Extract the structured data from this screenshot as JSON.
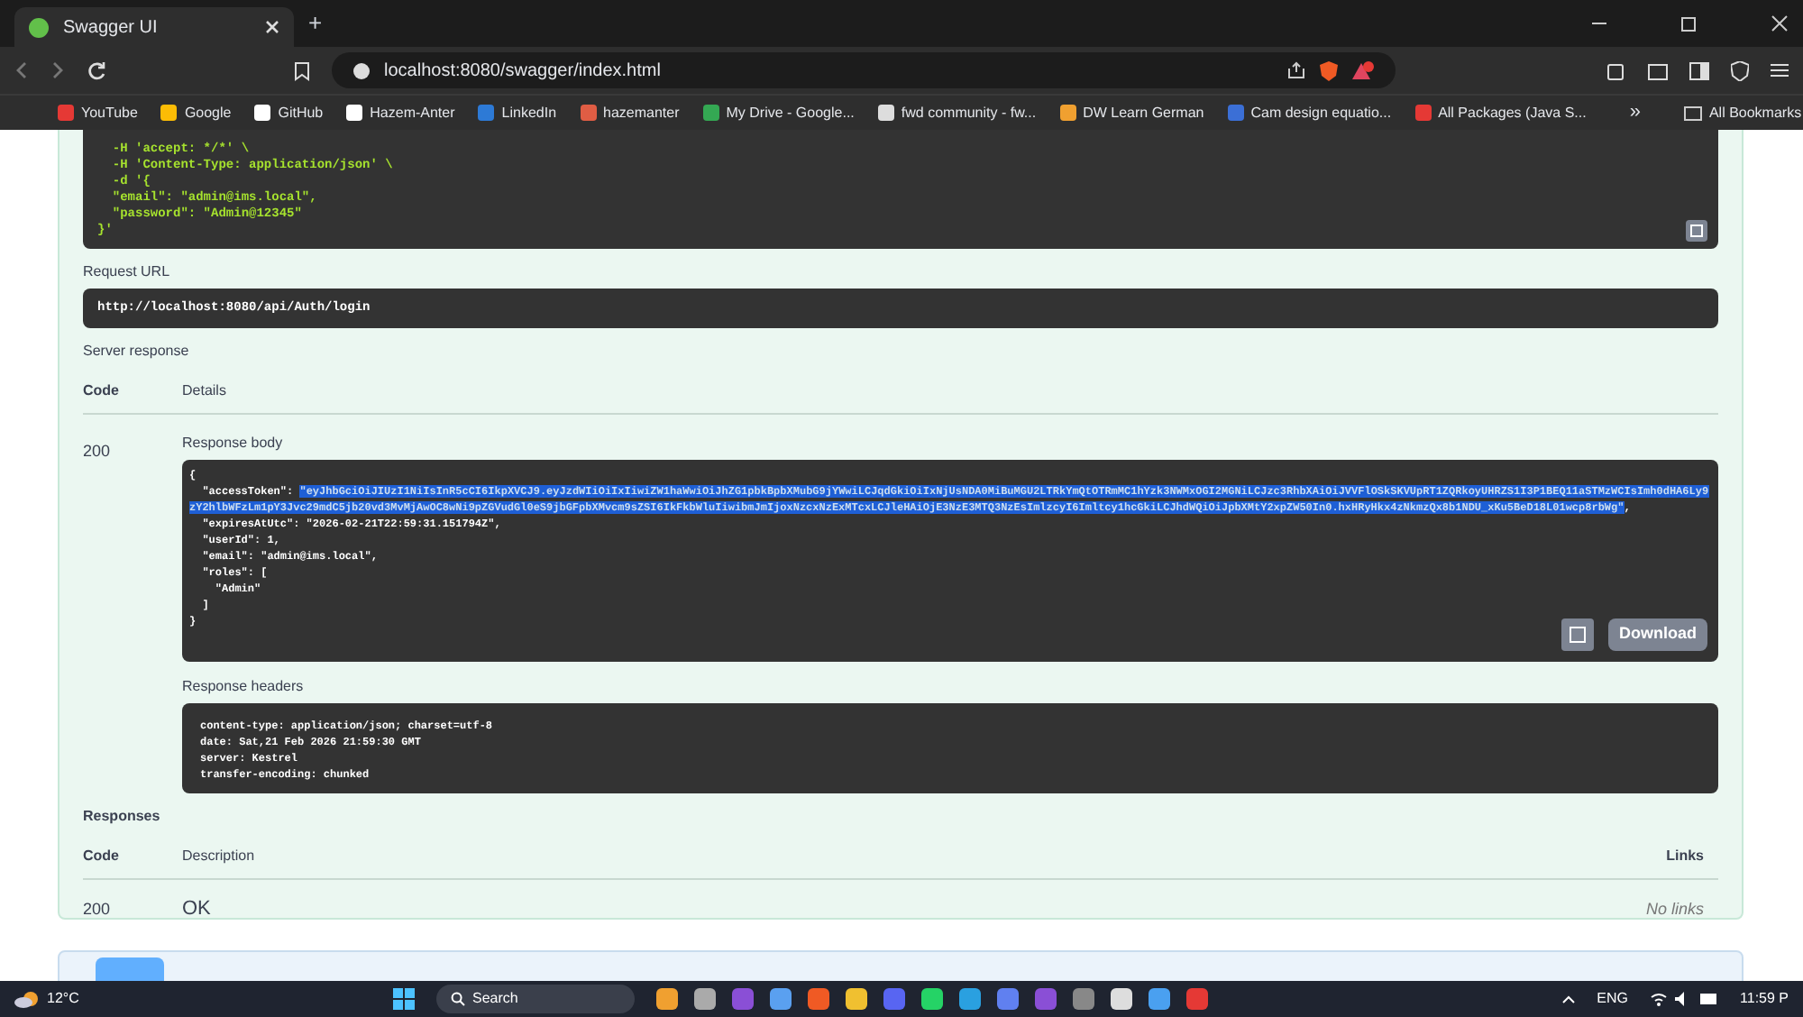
{
  "browser": {
    "tab_title": "Swagger UI",
    "new_tab": "+",
    "url": "localhost:8080/swagger/index.html",
    "bookmarks": [
      {
        "label": "YouTube",
        "color": "#e53935"
      },
      {
        "label": "Google",
        "color": "#fbbc05"
      },
      {
        "label": "GitHub",
        "color": "#ffffff"
      },
      {
        "label": "Hazem-Anter",
        "color": "#ffffff"
      },
      {
        "label": "LinkedIn",
        "color": "#2d7ad6"
      },
      {
        "label": "hazemanter",
        "color": "#e05d44"
      },
      {
        "label": "My Drive - Google...",
        "color": "#34a853"
      },
      {
        "label": "fwd community - fw...",
        "color": "#dddddd"
      },
      {
        "label": "DW Learn German",
        "color": "#f0a030"
      },
      {
        "label": "Cam design equatio...",
        "color": "#3b6fd6"
      },
      {
        "label": "All Packages (Java S...",
        "color": "#e53935"
      }
    ],
    "more": "»",
    "all_bookmarks": "All Bookmarks"
  },
  "curl": {
    "lines": [
      "  -H 'accept: */*' \\",
      "  -H 'Content-Type: application/json' \\",
      "  -d '{",
      "  \"email\": \"admin@ims.local\",",
      "  \"password\": \"Admin@12345\"",
      "}'"
    ]
  },
  "request_url": {
    "label": "Request URL",
    "value": "http://localhost:8080/api/Auth/login"
  },
  "server_response": {
    "label": "Server response",
    "columns": [
      "Code",
      "Details"
    ],
    "code": "200",
    "body_label": "Response body",
    "body_lines": [
      {
        "text": "{"
      },
      {
        "text": "  \"accessToken\": ",
        "highlight": "\"eyJhbGciOiJIUzI1NiIsInR5cCI6IkpXVCJ9.eyJzdWIiOiIxIiwiZW1haWwiOiJhZG1pbkBpbXMubG9jYWwiLCJqdGkiOiIxNjUsNDA0MiBuMGU2LTRkYmQtOTRmMC1hYzk3NWMxOGI2MGNiLCJzc3RhbXAiOiJVVFlOSkSKVUpRT1ZQRkoyUHRZS1I3P1BEQ11aSTMzWCIsImh0dHA6Ly9zY2hlbWFzLm1pY3Jvc29mdC5jb20vd3MvMjAwOC8wNi9pZGVudGl0eS9jbGFpbXMvcm9sZSI6IkFkbWluIiwibmJmIjoxNzcxNzExMTcxLCJleHAiOjE3NzE3MTQ3NzEsImlzcyI6Imltcy1hcGkiLCJhdWQiOiJpbXMtY2xpZW50In0.hxHRyHkx4zNkmzQx8b1NDU_xKu5BeD18L01wcp8rbWg\"",
        "tail": ","
      },
      {
        "text": "  \"expiresAtUtc\": \"2026-02-21T22:59:31.151794Z\","
      },
      {
        "text": "  \"userId\": 1,"
      },
      {
        "text": "  \"email\": \"admin@ims.local\","
      },
      {
        "text": "  \"roles\": ["
      },
      {
        "text": "    \"Admin\""
      },
      {
        "text": "  ]"
      },
      {
        "text": "}"
      }
    ],
    "download": "Download",
    "headers_label": "Response headers",
    "header_lines": [
      "content-type: application/json; charset=utf-8",
      "date: Sat,21 Feb 2026 21:59:30 GMT",
      "server: Kestrel",
      "transfer-encoding: chunked"
    ]
  },
  "responses": {
    "label": "Responses",
    "columns": [
      "Code",
      "Description",
      "Links"
    ],
    "rows": [
      {
        "code": "200",
        "description": "OK",
        "links": "No links"
      }
    ]
  },
  "taskbar": {
    "temperature": "12°C",
    "search": "Search",
    "language": "ENG",
    "time": "11:59 P"
  }
}
